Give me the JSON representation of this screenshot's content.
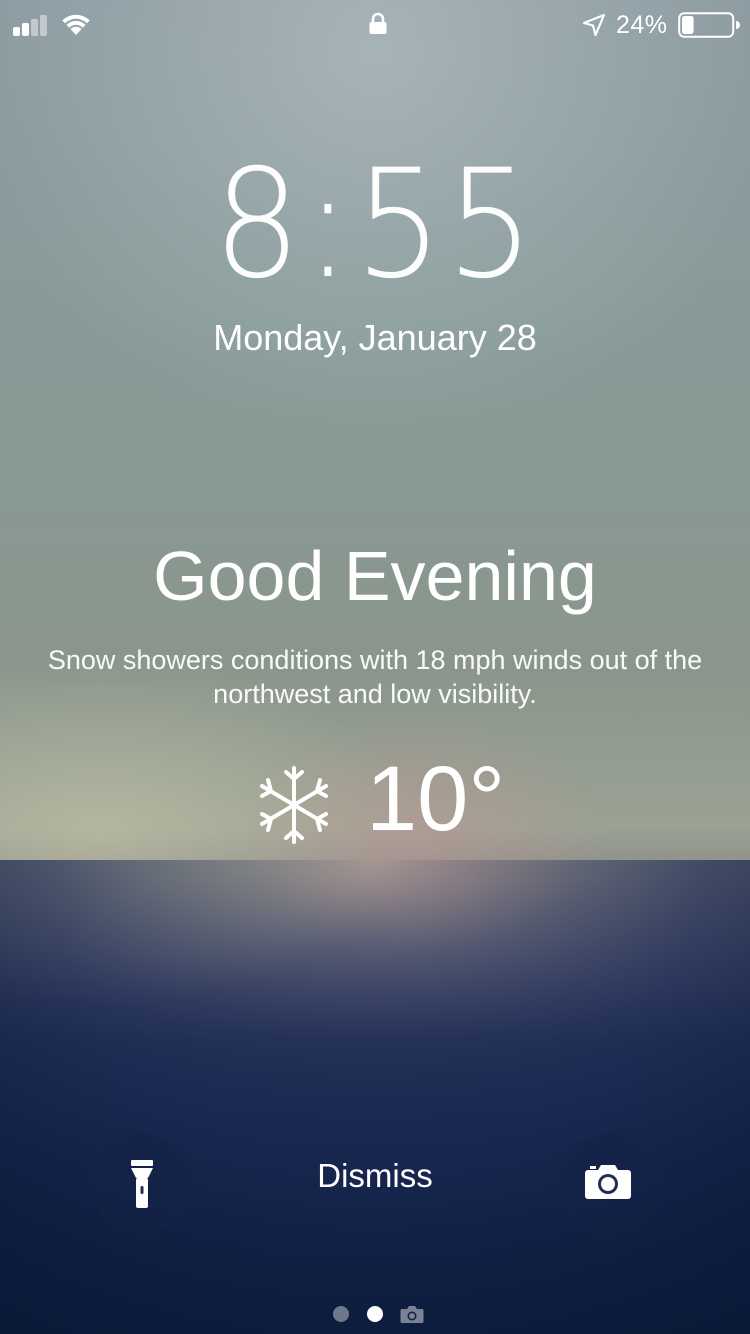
{
  "status_bar": {
    "battery_percent": "24%",
    "battery_level": 0.24,
    "signal_bars": 2,
    "icons": [
      "signal-icon",
      "wifi-icon",
      "lock-icon",
      "location-icon",
      "battery-icon"
    ]
  },
  "lock_screen": {
    "time": "8:55",
    "date": "Monday, January 28"
  },
  "weather": {
    "greeting": "Good Evening",
    "description": "Snow showers conditions with 18 mph winds out of the northwest and low visibility.",
    "icon": "snowflake-icon",
    "temperature": "10°"
  },
  "controls": {
    "dismiss_label": "Dismiss",
    "left_icon": "flashlight-icon",
    "right_icon": "camera-icon"
  },
  "page_indicator": {
    "pages": 3,
    "current": 2,
    "last_icon": "camera-icon"
  },
  "colors": {
    "text": "#ffffff",
    "control_bg": "#142346"
  }
}
